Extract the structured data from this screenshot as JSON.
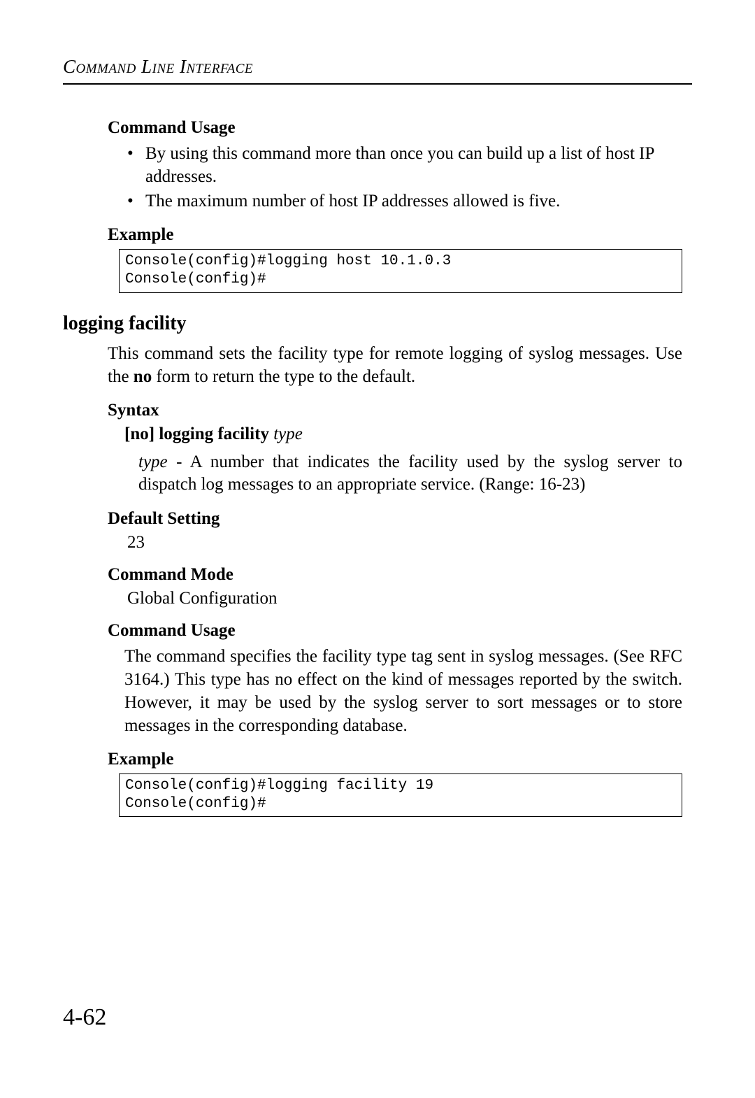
{
  "running_head": "Command Line Interface",
  "prev": {
    "usage_head": "Command Usage",
    "bullets": [
      "By using this command more than once you can build up a list of host IP addresses.",
      "The maximum number of host IP addresses allowed is five."
    ],
    "example_head": "Example",
    "example_code": "Console(config)#logging host 10.1.0.3\nConsole(config)#"
  },
  "section": {
    "title": "logging facility",
    "intro_pre": "This command sets the facility type for remote logging of syslog messages. Use the ",
    "intro_bold": "no",
    "intro_post": " form to return the type to the default.",
    "syntax_head": "Syntax",
    "syntax_prefix": "[",
    "syntax_no": "no",
    "syntax_mid": "] ",
    "syntax_cmd": "logging facility",
    "syntax_arg": "type",
    "arg_name": "type",
    "arg_desc": " - A number that indicates the facility used by the syslog server to dispatch log messages to an appropriate service. (Range: 16-23)",
    "default_head": "Default Setting",
    "default_value": "23",
    "mode_head": "Command Mode",
    "mode_value": "Global Configuration",
    "usage_head": "Command Usage",
    "usage_text": "The command specifies the facility type tag sent in syslog messages. (See RFC 3164.) This type has no effect on the kind of messages reported by the switch. However, it may be used by the syslog server to sort messages or to store messages in the corresponding database.",
    "example_head": "Example",
    "example_code": "Console(config)#logging facility 19\nConsole(config)#"
  },
  "page_number": "4-62"
}
